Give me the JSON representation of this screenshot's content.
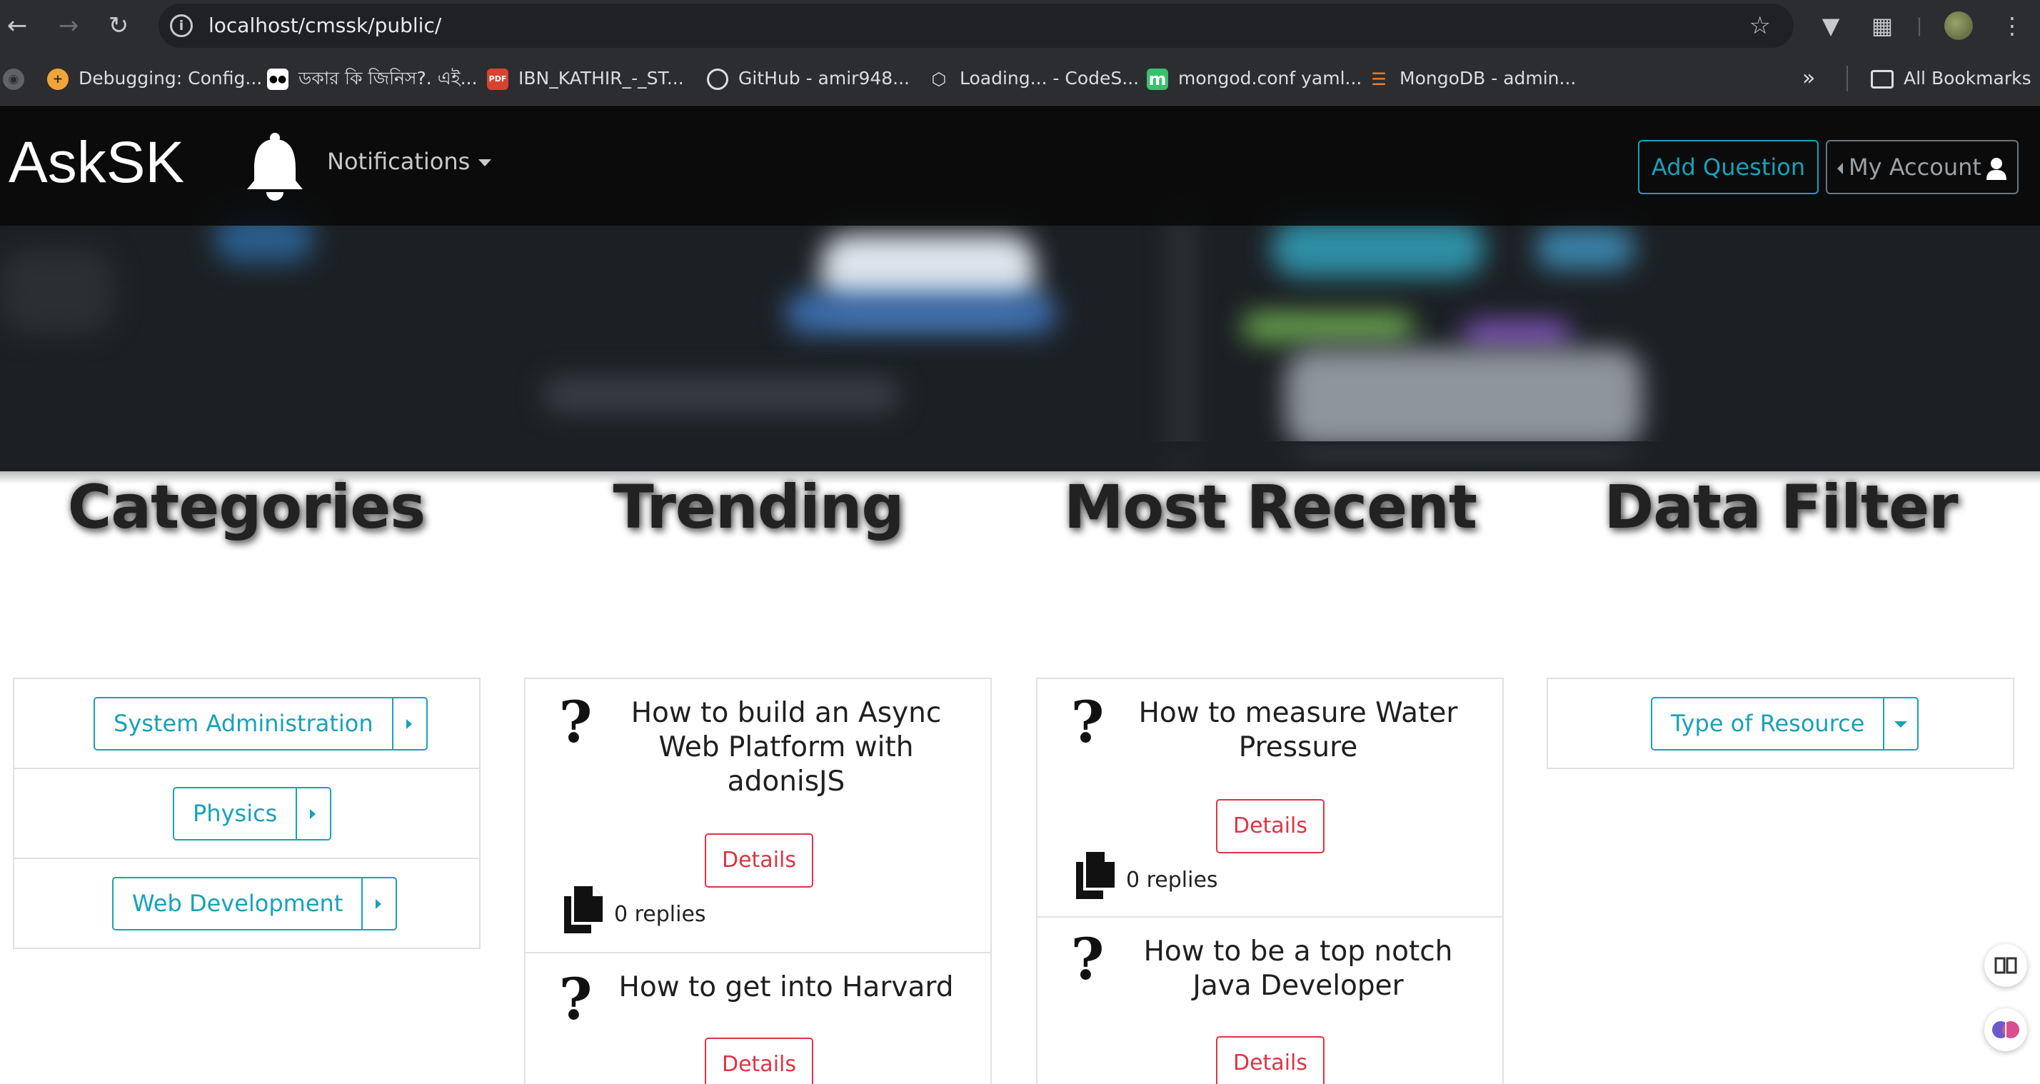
{
  "browser": {
    "url": "localhost/cmssk/public/",
    "bookmarks": [
      {
        "label": "Debugging: Config...",
        "icon": "plus-circle-icon",
        "color": "#f0a43a"
      },
      {
        "label": "ডকার কি জিনিস?. এই...",
        "icon": "medium-icon",
        "color": "#ffffff"
      },
      {
        "label": "IBN_KATHIR_-_ST...",
        "icon": "pdf-icon",
        "color": "#d9422f"
      },
      {
        "label": "GitHub - amir948...",
        "icon": "github-icon",
        "color": "#dcdde0"
      },
      {
        "label": "Loading... - CodeS...",
        "icon": "codesandbox-icon",
        "color": "#dcdde0"
      },
      {
        "label": "mongod.conf yaml...",
        "icon": "m-icon",
        "color": "#39c06d"
      },
      {
        "label": "MongoDB - admin...",
        "icon": "stackoverflow-icon",
        "color": "#f48024"
      }
    ],
    "all_bookmarks_label": "All Bookmarks"
  },
  "site": {
    "brand": "AskSK",
    "notifications_label": "Notifications",
    "add_question_label": "Add Question",
    "my_account_label": "My Account"
  },
  "columns": {
    "categories": {
      "heading": "Categories",
      "items": [
        {
          "label": "System Administration"
        },
        {
          "label": "Physics"
        },
        {
          "label": "Web Development"
        }
      ]
    },
    "trending": {
      "heading": "Trending",
      "questions": [
        {
          "title": "How to build an Async Web Platform with adonisJS",
          "details_label": "Details",
          "replies": "0 replies"
        },
        {
          "title": "How to get into Harvard",
          "details_label": "Details"
        }
      ]
    },
    "most_recent": {
      "heading": "Most Recent",
      "questions": [
        {
          "title": "How to measure Water Pressure",
          "details_label": "Details",
          "replies": "0 replies"
        },
        {
          "title": "How to be a top notch Java Developer",
          "details_label": "Details"
        }
      ]
    },
    "data_filter": {
      "heading": "Data Filter",
      "select_label": "Type of Resource"
    }
  },
  "colors": {
    "info": "#17a2b8",
    "danger": "#dc3545",
    "chrome_bg": "#2c2d30"
  }
}
